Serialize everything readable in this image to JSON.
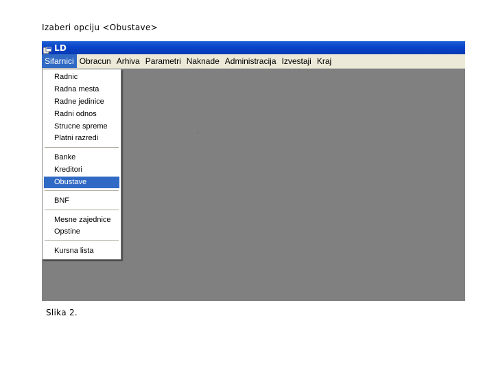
{
  "instruction": "Izaberi opciju <Obustave>",
  "caption": "Slika 2.",
  "window": {
    "title": "LD"
  },
  "menubar": {
    "items": [
      "Sifarnici",
      "Obracun",
      "Arhiva",
      "Parametri",
      "Naknade",
      "Administracija",
      "Izvestaji",
      "Kraj"
    ],
    "active": "Sifarnici"
  },
  "dropdown": {
    "items": [
      "Radnic",
      "Radna mesta",
      "Radne jedinice",
      "Radni odnos",
      "Strucne spreme",
      "Platni razredi",
      "Banke",
      "Kreditori",
      "Obustave",
      "BNF",
      "Mesne zajednice",
      "Opstine",
      "Kursna lista"
    ],
    "selected": "Obustave"
  },
  "colors": {
    "titlebar": "#0a46c9",
    "menubar": "#ece9d8",
    "workspace": "#808080",
    "selection": "#316ac5"
  }
}
